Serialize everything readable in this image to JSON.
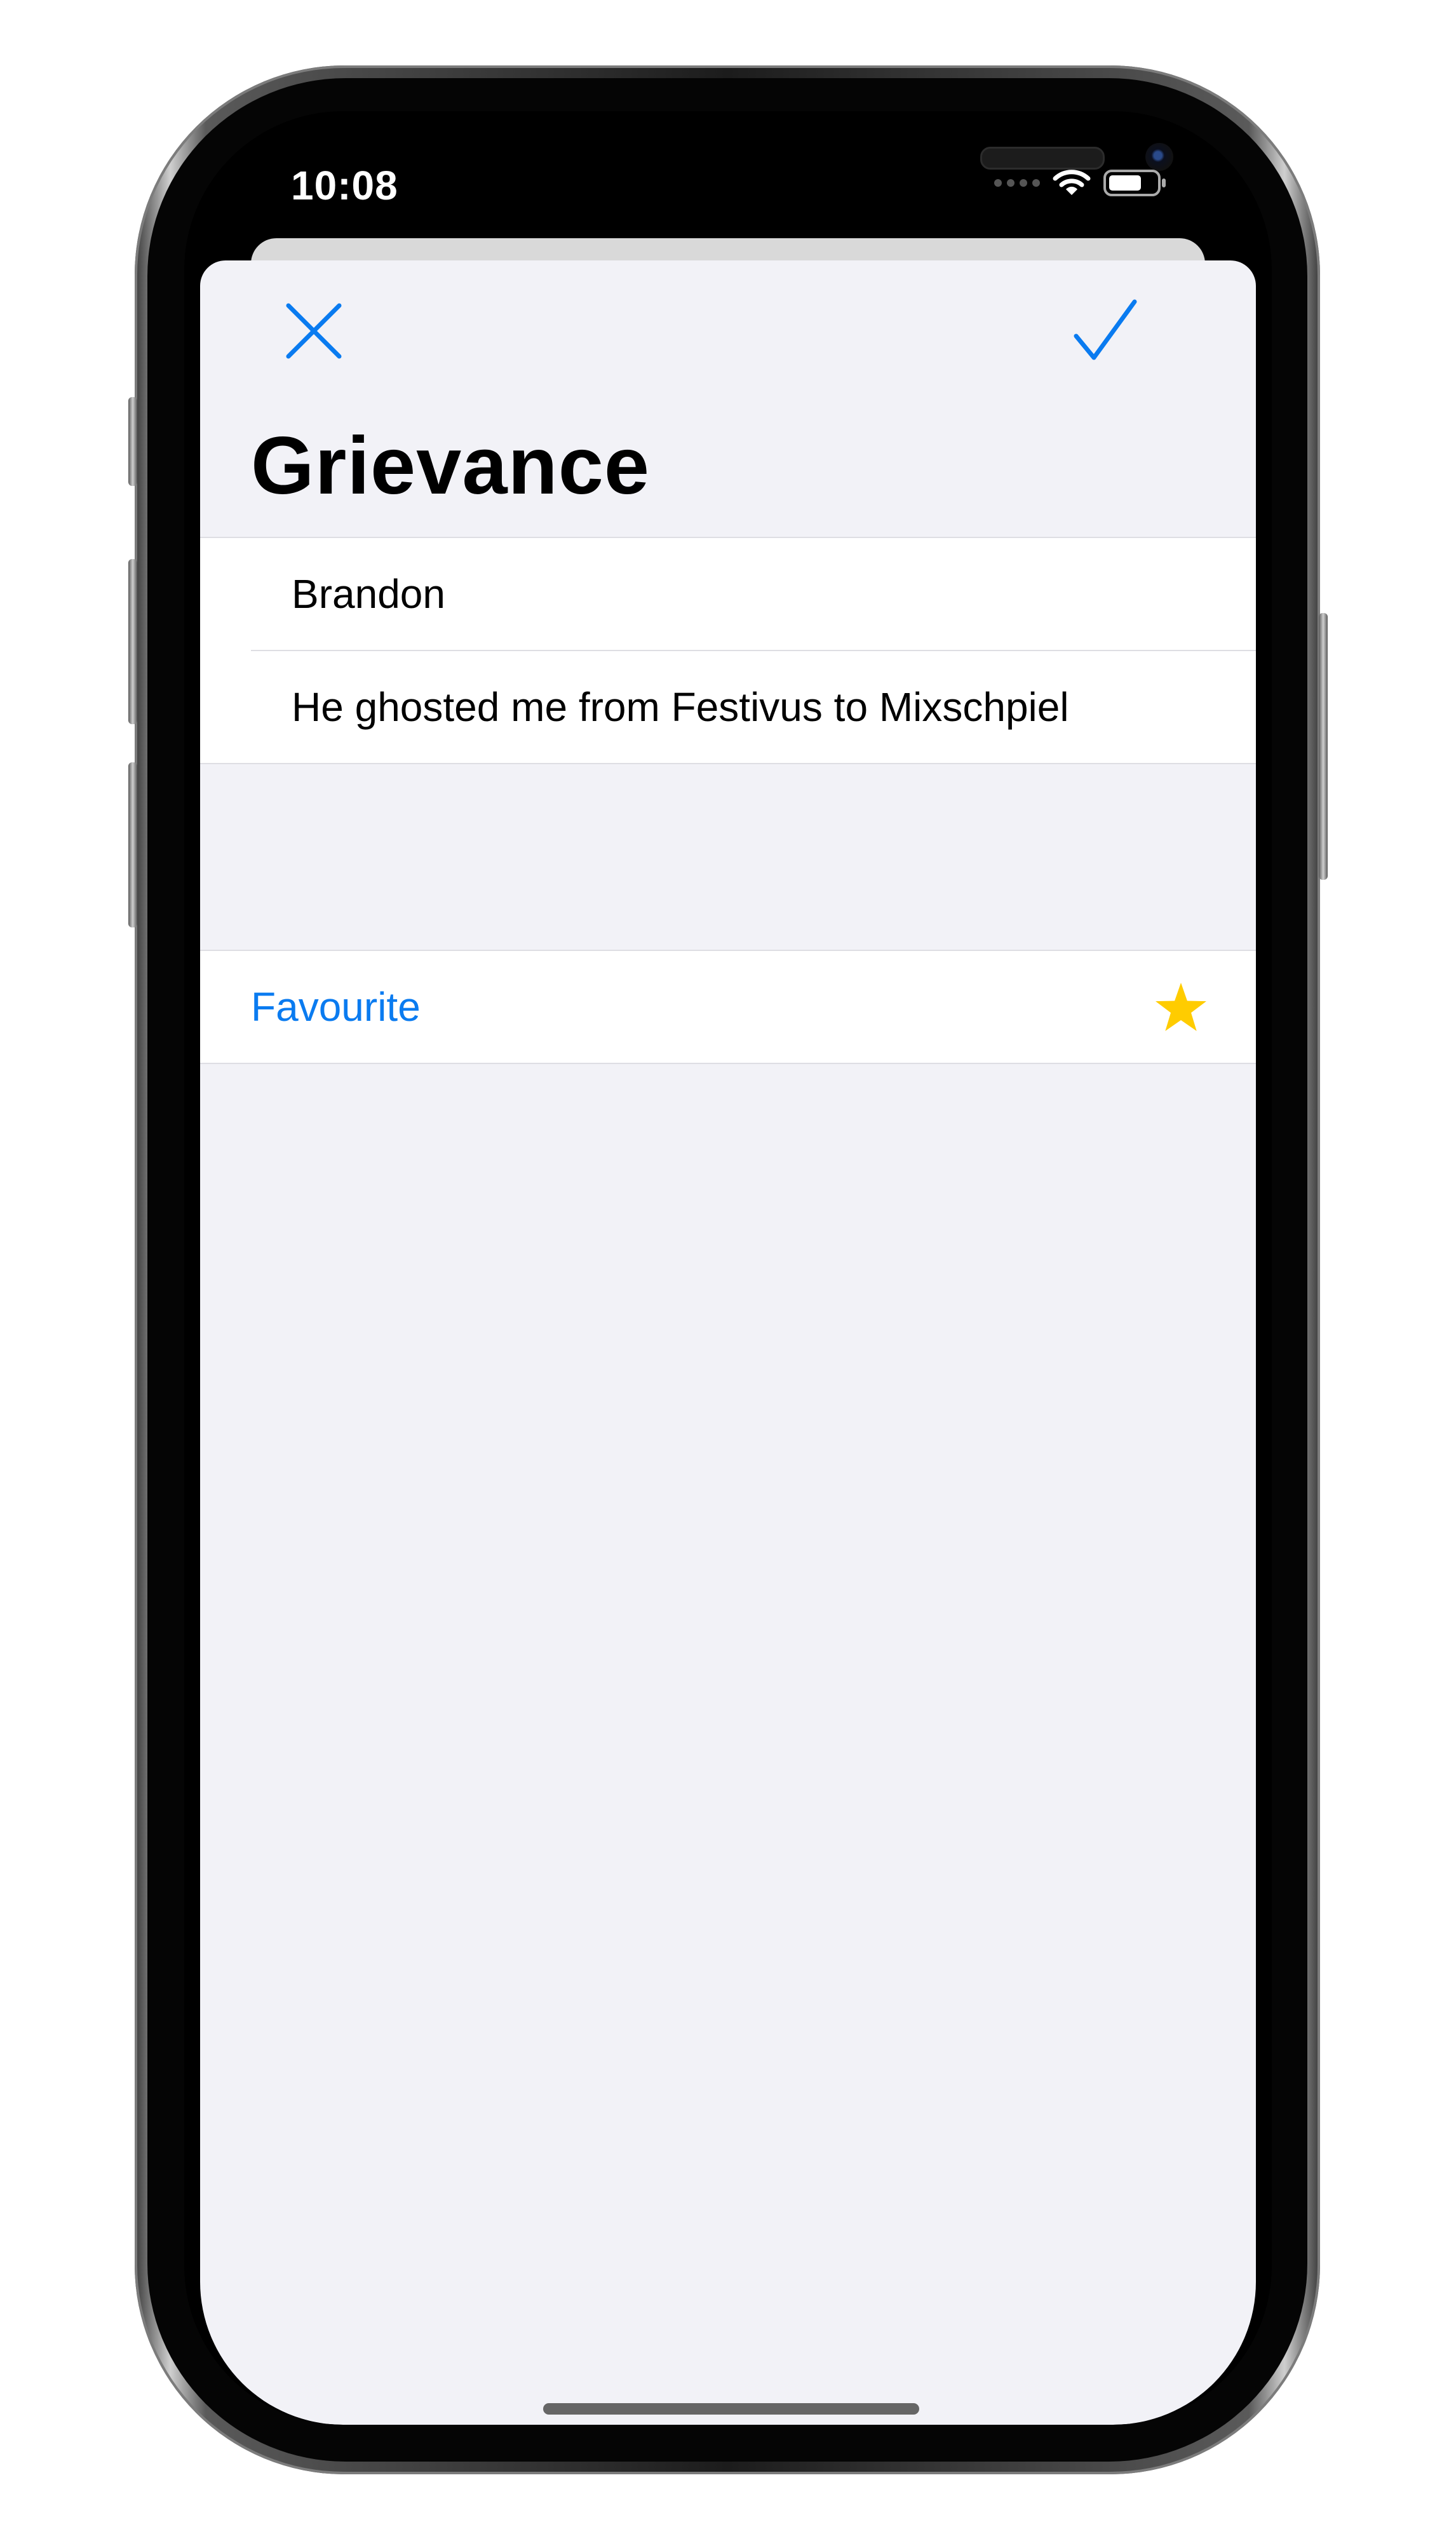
{
  "status_bar": {
    "time": "10:08"
  },
  "nav": {
    "cancel_icon": "close-x-icon",
    "confirm_icon": "checkmark-icon"
  },
  "form": {
    "title": "Grievance",
    "fields": [
      {
        "value": "Brandon"
      },
      {
        "value": "He ghosted me from Festivus to Mixschpiel"
      }
    ],
    "favourite": {
      "label": "Favourite",
      "icon": "star-filled-icon",
      "checked": true
    }
  },
  "colors": {
    "accent": "#0a7bf0",
    "star": "#ffcc00",
    "background": "#f2f2f7"
  }
}
